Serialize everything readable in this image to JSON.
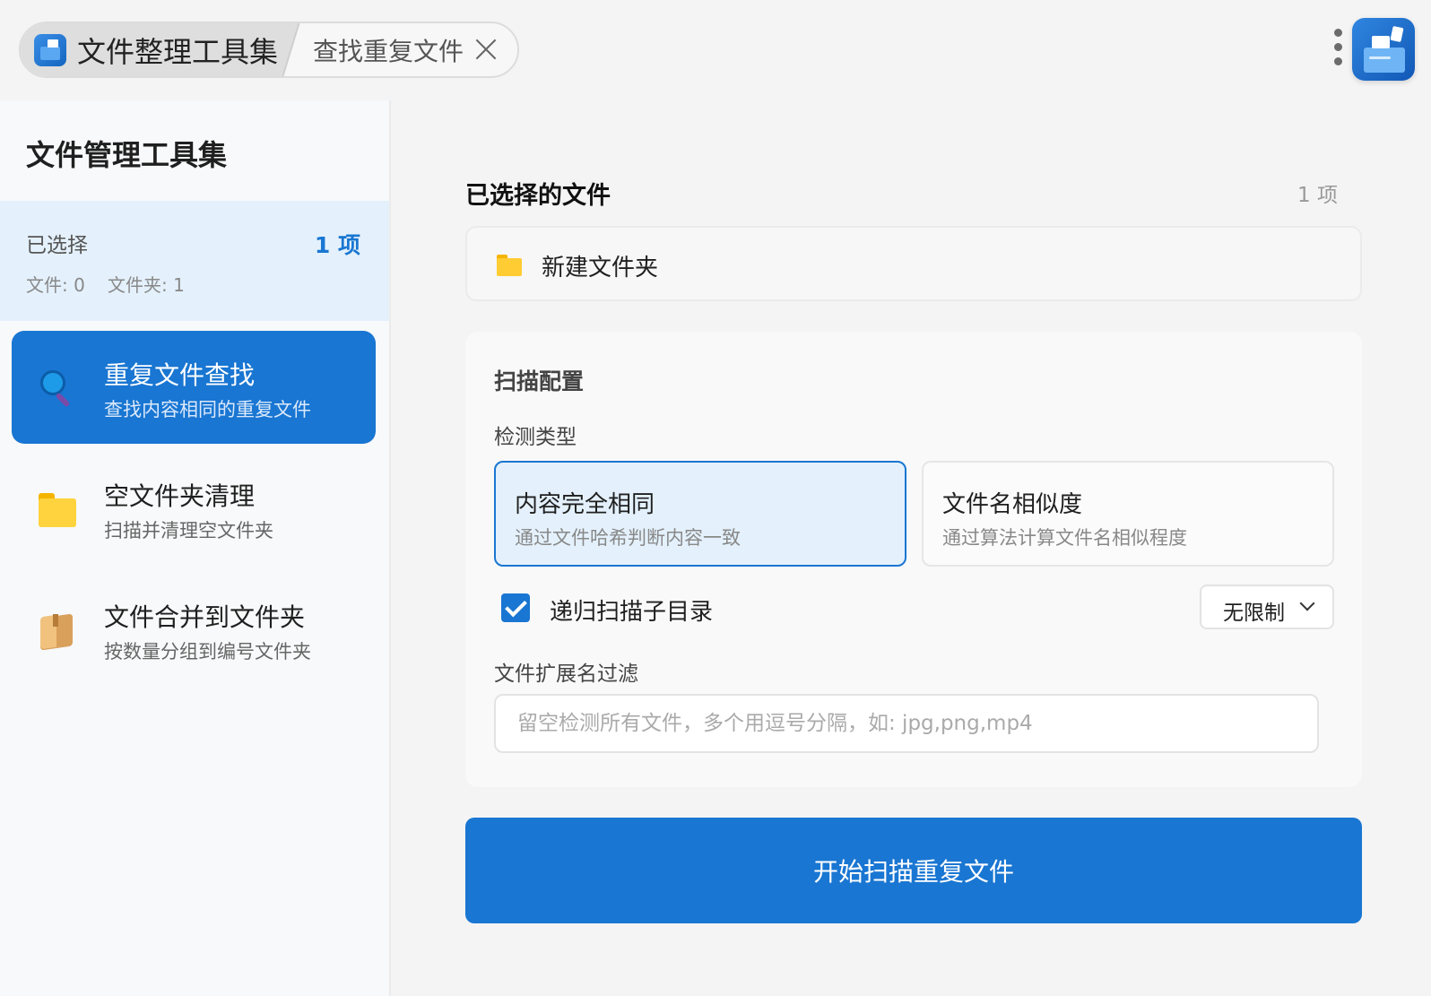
{
  "titlebar": {
    "app_tab_label": "文件整理工具集",
    "tool_tab_label": "查找重复文件"
  },
  "sidebar": {
    "title": "文件管理工具集",
    "selection": {
      "label": "已选择",
      "count": "1 项",
      "files": "文件: 0",
      "folders": "文件夹: 1"
    },
    "items": [
      {
        "title": "重复文件查找",
        "subtitle": "查找内容相同的重复文件",
        "icon": "magnifier-icon",
        "active": true
      },
      {
        "title": "空文件夹清理",
        "subtitle": "扫描并清理空文件夹",
        "icon": "folder-icon",
        "active": false
      },
      {
        "title": "文件合并到文件夹",
        "subtitle": "按数量分组到编号文件夹",
        "icon": "package-icon",
        "active": false
      }
    ]
  },
  "main": {
    "selected_title": "已选择的文件",
    "selected_count": "1 项",
    "selected_files": [
      {
        "name": "新建文件夹",
        "icon": "folder-icon"
      }
    ],
    "config": {
      "title": "扫描配置",
      "detect_label": "检测类型",
      "options": [
        {
          "title": "内容完全相同",
          "subtitle": "通过文件哈希判断内容一致",
          "selected": true
        },
        {
          "title": "文件名相似度",
          "subtitle": "通过算法计算文件名相似程度",
          "selected": false
        }
      ],
      "recursive_label": "递归扫描子目录",
      "recursive_checked": true,
      "depth_value": "无限制",
      "ext_label": "文件扩展名过滤",
      "ext_placeholder": "留空检测所有文件，多个用逗号分隔，如: jpg,png,mp4",
      "ext_value": ""
    },
    "start_button": "开始扫描重复文件"
  },
  "colors": {
    "accent": "#1976d2",
    "selection_bg": "#e4f1fc"
  }
}
